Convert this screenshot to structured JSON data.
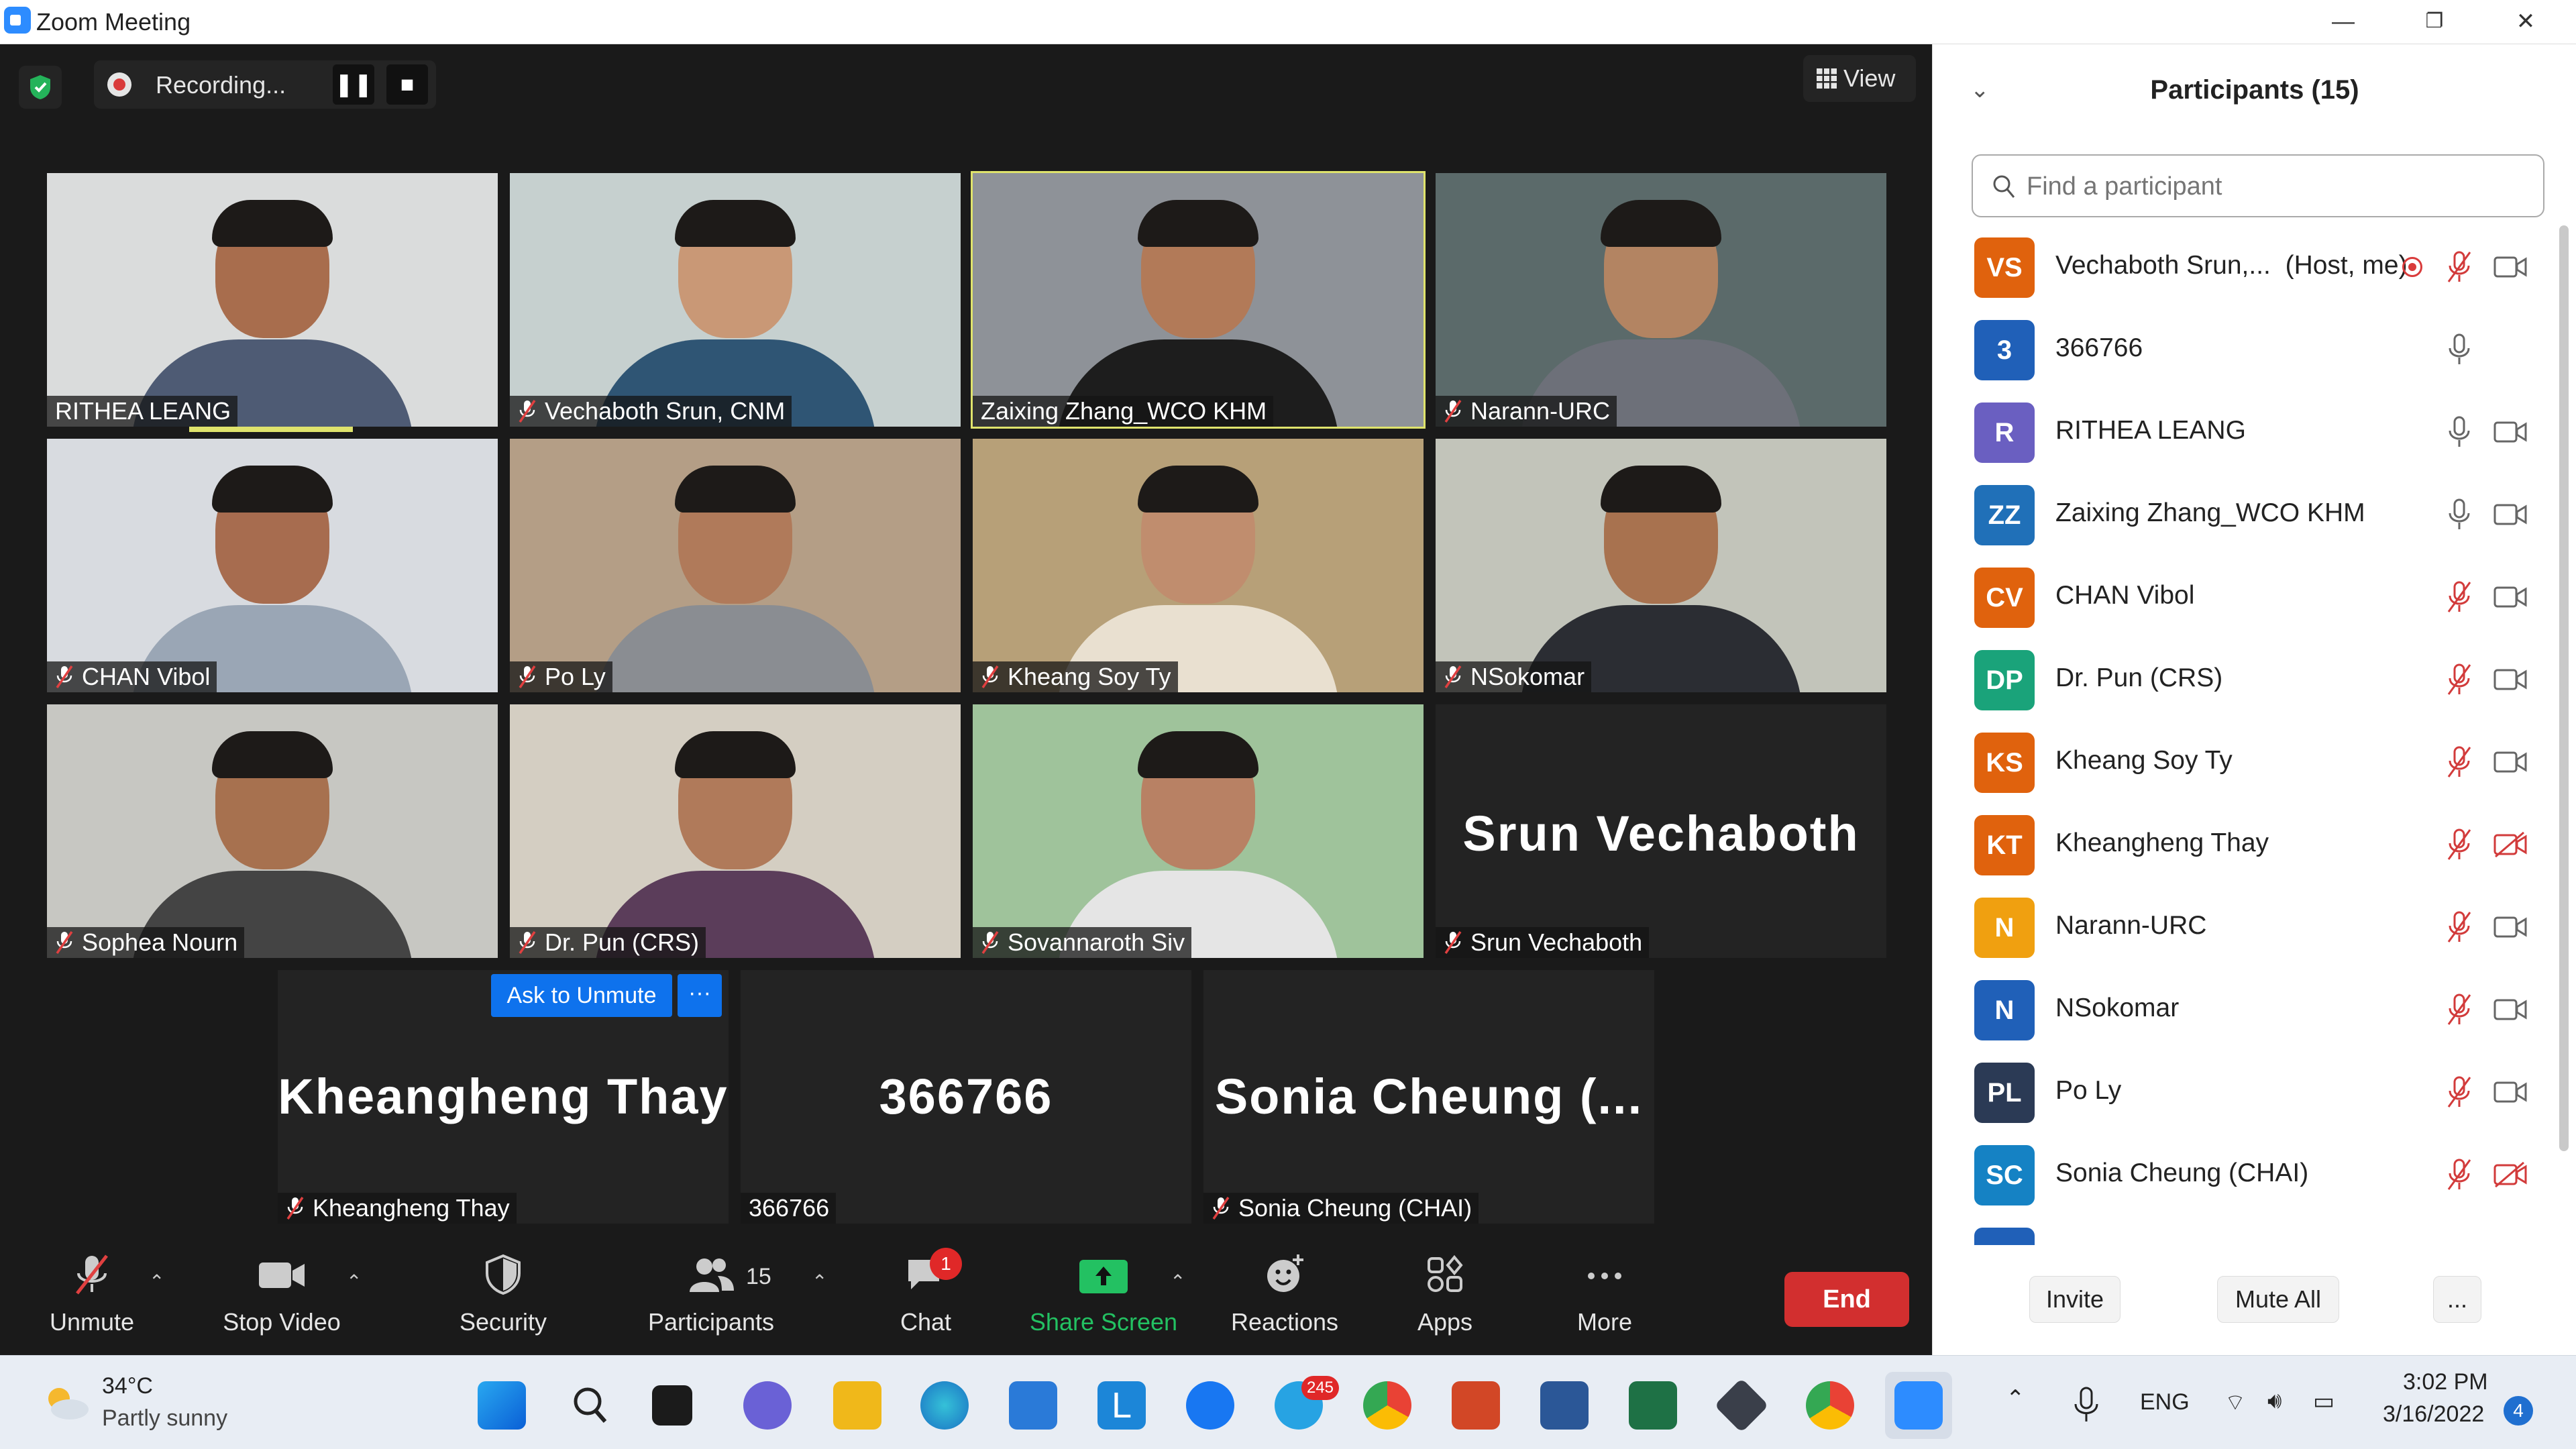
{
  "window": {
    "title": "Zoom Meeting",
    "min": "—",
    "restore": "❐",
    "close": "✕"
  },
  "recording": {
    "label": "Recording...",
    "pause": "❚❚",
    "stop": "■"
  },
  "view": {
    "label": "View"
  },
  "tiles": [
    {
      "name": "RITHEA LEANG",
      "muted": false,
      "bg": "#dadcdc",
      "skin": "#a86d4d",
      "shirt": "#4e5b74"
    },
    {
      "name": "Vechaboth Srun, CNM",
      "muted": true,
      "bg": "#c6d0cf",
      "skin": "#c99876",
      "shirt": "#2f5574"
    },
    {
      "name": "Zaixing Zhang_WCO KHM",
      "muted": false,
      "bg": "#8e9298",
      "skin": "#b27a58",
      "shirt": "#1d1d1d"
    },
    {
      "name": "Narann-URC",
      "muted": true,
      "bg": "#5b6a6a",
      "skin": "#b38462",
      "shirt": "#6d7079"
    },
    {
      "name": "CHAN Vibol",
      "muted": true,
      "bg": "#d8dbe0",
      "skin": "#a76c4f",
      "shirt": "#9aa6b5"
    },
    {
      "name": "Po Ly",
      "muted": true,
      "bg": "#b49e86",
      "skin": "#b07a5a",
      "shirt": "#8a8d92"
    },
    {
      "name": "Kheang Soy Ty",
      "muted": true,
      "bg": "#b7a078",
      "skin": "#c08d6e",
      "shirt": "#e9e0d0"
    },
    {
      "name": "NSokomar",
      "muted": true,
      "bg": "#c2c4ba",
      "skin": "#a8724f",
      "shirt": "#2b2d33"
    },
    {
      "name": "Sophea Nourn",
      "muted": true,
      "bg": "#c7c7c2",
      "skin": "#a7714f",
      "shirt": "#444444"
    },
    {
      "name": "Dr. Pun (CRS)",
      "muted": true,
      "bg": "#d4cec2",
      "skin": "#b07a5a",
      "shirt": "#5b3d5a"
    },
    {
      "name": "Sovannaroth Siv",
      "muted": true,
      "bg": "#9fc39b",
      "skin": "#b88164",
      "shirt": "#e5e5e5"
    },
    {
      "name": "Srun Vechaboth",
      "muted": true,
      "big": "Srun Vechaboth"
    }
  ],
  "bottom_tiles": [
    {
      "big": "Kheangheng Thay",
      "name": "Kheangheng Thay",
      "muted": true
    },
    {
      "big": "366766",
      "name": "366766",
      "muted": false
    },
    {
      "big": "Sonia Cheung (...",
      "name": "Sonia Cheung (CHAI)",
      "muted": true
    }
  ],
  "ask_to_unmute": "Ask to Unmute",
  "ask_more": "···",
  "toolbar": {
    "unmute": "Unmute",
    "stop_video": "Stop Video",
    "security": "Security",
    "participants": "Participants",
    "participants_count": "15",
    "chat": "Chat",
    "chat_badge": "1",
    "share_screen": "Share Screen",
    "reactions": "Reactions",
    "apps": "Apps",
    "more": "More",
    "end": "End"
  },
  "panel": {
    "title": "Participants (15)",
    "search_placeholder": "Find a participant",
    "invite": "Invite",
    "mute_all": "Mute All",
    "more": "...",
    "participants": [
      {
        "initials": "VS",
        "name": "Vechaboth Srun,...",
        "suffix": "(Host, me)",
        "color": "#e0620d",
        "mic": "muted",
        "cam": "on",
        "rec": true
      },
      {
        "initials": "3",
        "name": "366766",
        "suffix": "",
        "color": "#2060b8",
        "mic": "on",
        "cam": "none"
      },
      {
        "initials": "R",
        "name": "RITHEA LEANG",
        "suffix": "",
        "color": "#6a5fc1",
        "mic": "on",
        "cam": "on"
      },
      {
        "initials": "ZZ",
        "name": "Zaixing Zhang_WCO KHM",
        "suffix": "",
        "color": "#2070b8",
        "mic": "on",
        "cam": "on"
      },
      {
        "initials": "CV",
        "name": "CHAN Vibol",
        "suffix": "",
        "color": "#e0620d",
        "mic": "muted",
        "cam": "on"
      },
      {
        "initials": "DP",
        "name": "Dr. Pun (CRS)",
        "suffix": "",
        "color": "#1aa37a",
        "mic": "muted",
        "cam": "on"
      },
      {
        "initials": "KS",
        "name": "Kheang Soy Ty",
        "suffix": "",
        "color": "#e0620d",
        "mic": "muted",
        "cam": "on"
      },
      {
        "initials": "KT",
        "name": "Kheangheng Thay",
        "suffix": "",
        "color": "#e0620d",
        "mic": "muted",
        "cam": "off"
      },
      {
        "initials": "N",
        "name": "Narann-URC",
        "suffix": "",
        "color": "#f0a010",
        "mic": "muted",
        "cam": "on"
      },
      {
        "initials": "N",
        "name": "NSokomar",
        "suffix": "",
        "color": "#2060b8",
        "mic": "muted",
        "cam": "on"
      },
      {
        "initials": "PL",
        "name": "Po Ly",
        "suffix": "",
        "color": "#2b3a55",
        "mic": "muted",
        "cam": "on"
      },
      {
        "initials": "SC",
        "name": "Sonia Cheung (CHAI)",
        "suffix": "",
        "color": "#1582c4",
        "mic": "muted",
        "cam": "off"
      }
    ]
  },
  "taskbar": {
    "weather_temp": "34°C",
    "weather_desc": "Partly sunny",
    "telegram_badge": "245",
    "lang": "ENG",
    "time": "3:02 PM",
    "date": "3/16/2022",
    "notif_count": "4"
  }
}
